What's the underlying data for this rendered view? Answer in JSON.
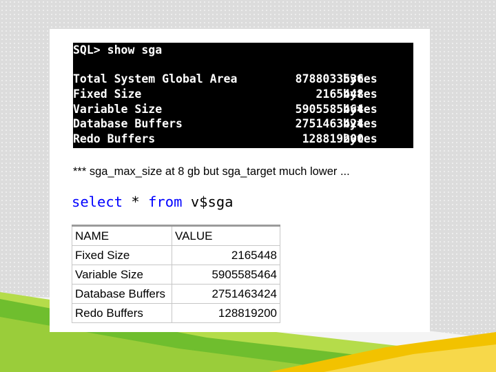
{
  "terminal": {
    "prompt": "SQL> show sga",
    "rows": [
      {
        "label": "Total System Global Area",
        "value": "8788033536",
        "unit": "bytes"
      },
      {
        "label": "Fixed Size",
        "value": "2165448",
        "unit": "bytes"
      },
      {
        "label": "Variable Size",
        "value": "5905585464",
        "unit": "bytes"
      },
      {
        "label": "Database Buffers",
        "value": "2751463424",
        "unit": "bytes"
      },
      {
        "label": "Redo Buffers",
        "value": "128819200",
        "unit": "bytes"
      }
    ]
  },
  "note": "*** sga_max_size at 8 gb but sga_target much lower ...",
  "query": {
    "kw_select": "select",
    "star": "*",
    "kw_from": "from",
    "table": "v$sga"
  },
  "result_table": {
    "headers": [
      "NAME",
      "VALUE"
    ],
    "rows": [
      [
        "Fixed Size",
        "2165448"
      ],
      [
        "Variable Size",
        "5905585464"
      ],
      [
        "Database Buffers",
        "2751463424"
      ],
      [
        "Redo Buffers",
        "128819200"
      ]
    ]
  },
  "colors": {
    "keyword": "#0000ff",
    "deco_green_dark": "#6fbe2e",
    "deco_green_light": "#b5dc4a",
    "deco_yellow": "#f2c200"
  }
}
